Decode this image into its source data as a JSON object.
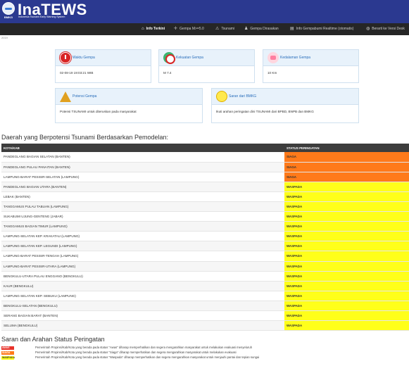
{
  "header": {
    "brand": "InaTEWS",
    "subtitle": "Indonesia Tsunami Early Warning System",
    "badge_text": "BMKG",
    "bg_color": "#2b3990"
  },
  "nav": {
    "items": [
      {
        "label": "Info Terkini",
        "icon": "home-icon",
        "active": true
      },
      {
        "label": "Gempa M>=5.0",
        "icon": "cross-icon",
        "active": false
      },
      {
        "label": "Tsunami",
        "icon": "warning-icon",
        "active": false
      },
      {
        "label": "Gempa Dirasakan",
        "icon": "people-icon",
        "active": false
      },
      {
        "label": "Info Gempabumi Realtime (otomatis)",
        "icon": "list-icon",
        "active": false
      },
      {
        "label": "Berarti ke Versi Desk",
        "icon": "globe-icon",
        "active": false
      }
    ]
  },
  "breadcrumb": "2019",
  "cards": {
    "waktu": {
      "title": "Waktu Gempa",
      "value": "02-08-19 19:03:21 WIB"
    },
    "kekuatan": {
      "title": "Kekuatan Gempa",
      "value": "M 7.4"
    },
    "kedalaman": {
      "title": "Kedalaman Gempa",
      "value": "10 Km"
    },
    "potensi": {
      "title": "Potensi Gempa",
      "value": "Potensi TSUNAMI untuk diteruskan pada masyarakat"
    },
    "saran": {
      "title": "Saran dari BMKG",
      "value": "Ikuti arahan peringatan dini TSUNAMI dari BPBD, BNPB dan BMKG"
    }
  },
  "zones_section": {
    "title": "Daerah yang Berpotensi Tsunami Berdasarkan Pemodelan:",
    "col_area": "KOTA/KAB",
    "col_status": "STATUS PERINGATAN",
    "rows": [
      {
        "area": "PANDEGLANG BAGIAN SELATAN (BANTEN)",
        "status": "SIAGA"
      },
      {
        "area": "PANDEGLANG PULAU PANAITAN (BANTEN)",
        "status": "SIAGA"
      },
      {
        "area": "LAMPUNG-BARAT PESISIR-SELATAN (LAMPUNG)",
        "status": "SIAGA"
      },
      {
        "area": "PANDEGLANG BAGIAN UTARA (BANTEN)",
        "status": "WASPADA"
      },
      {
        "area": "LEBAK (BANTEN)",
        "status": "WASPADA"
      },
      {
        "area": "TANGGAMUS PULAU TABUAN (LAMPUNG)",
        "status": "WASPADA"
      },
      {
        "area": "SUKABUMI UJUNG-GENTENG (JABAR)",
        "status": "WASPADA"
      },
      {
        "area": "TANGGAMUS BAGIAN TIMUR (LAMPUNG)",
        "status": "WASPADA"
      },
      {
        "area": "LAMPUNG-SELATAN KEP. KRAKATAU (LAMPUNG)",
        "status": "WASPADA"
      },
      {
        "area": "LAMPUNG-SELATAN KEP. LEGUNDI (LAMPUNG)",
        "status": "WASPADA"
      },
      {
        "area": "LAMPUNG-BARAT PESISIR-TENGAH (LAMPUNG)",
        "status": "WASPADA"
      },
      {
        "area": "LAMPUNG-BARAT PESISIR-UTARA (LAMPUNG)",
        "status": "WASPADA"
      },
      {
        "area": "BENGKULU-UTARA PULAU ENGGANO (BENGKULU)",
        "status": "WASPADA"
      },
      {
        "area": "KAUR (BENGKULU)",
        "status": "WASPADA"
      },
      {
        "area": "LAMPUNG-SELATAN KEP. SEBUKU (LAMPUNG)",
        "status": "WASPADA"
      },
      {
        "area": "BENGKULU-SELATAN (BENGKULU)",
        "status": "WASPADA"
      },
      {
        "area": "SERANG BAGIAN BARAT (BANTEN)",
        "status": "WASPADA"
      },
      {
        "area": "SELUMA (BENGKULU)",
        "status": "WASPADA"
      }
    ]
  },
  "legend_section": {
    "title": "Saran dan Arahan Status Peringatan",
    "items": [
      {
        "badge": "AWAS",
        "color": "#e8322a",
        "text": "Pemerintah Propinsi/Kab/Kota yang berada pada status \"Awas\" diharap memperhatikan dan segera mengarahkan masyarakat untuk melakukan evakuasi menyeluruh"
      },
      {
        "badge": "SIAGA",
        "color": "#ff7a1a",
        "text": "Pemerintah Propinsi/Kab/Kota yang berada pada status \"Siaga\" diharap memperhatikan dan segera mengarahkan masyarakat untuk melakukan evakuasi"
      },
      {
        "badge": "WASPADA",
        "color": "#ffff1a",
        "text": "Pemerintah Propinsi/Kab/Kota yang berada pada status \"Waspada\" diharap memperhatikan dan segera mengarahkan masyarakat untuk menjauhi pantai dan tepian sungai"
      }
    ]
  }
}
